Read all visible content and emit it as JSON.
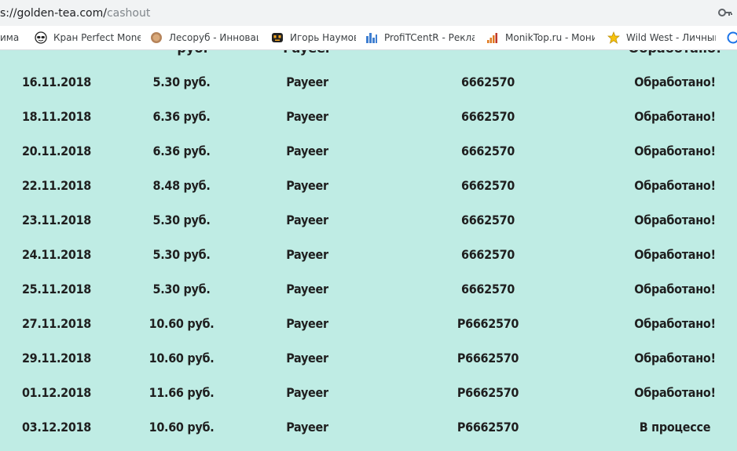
{
  "browser": {
    "url_host": "s://golden-tea.com/",
    "url_path": "cashout"
  },
  "bookmarks": [
    {
      "label": "има",
      "icon": "bookmark-icon"
    },
    {
      "label": "Кран Perfect Money",
      "icon": "mask-icon"
    },
    {
      "label": "Лесоруб - Инновац",
      "icon": "coin-icon"
    },
    {
      "label": "Игорь Наумов",
      "icon": "robot-icon"
    },
    {
      "label": "ProfiTCentR - Реклам",
      "icon": "bar-chart-icon"
    },
    {
      "label": "MonikTop.ru - Мони",
      "icon": "signal-icon"
    },
    {
      "label": "Wild West - Личный",
      "icon": "star-icon"
    },
    {
      "label": "",
      "icon": "globe-icon"
    }
  ],
  "table": {
    "columns": [
      "date",
      "amount",
      "system",
      "wallet",
      "status"
    ],
    "partial_row": [
      "руб.",
      "Payeer",
      "Обработано!"
    ],
    "rows": [
      [
        "16.11.2018",
        "5.30 руб.",
        "Payeer",
        "6662570",
        "Обработано!"
      ],
      [
        "18.11.2018",
        "6.36 руб.",
        "Payeer",
        "6662570",
        "Обработано!"
      ],
      [
        "20.11.2018",
        "6.36 руб.",
        "Payeer",
        "6662570",
        "Обработано!"
      ],
      [
        "22.11.2018",
        "8.48 руб.",
        "Payeer",
        "6662570",
        "Обработано!"
      ],
      [
        "23.11.2018",
        "5.30 руб.",
        "Payeer",
        "6662570",
        "Обработано!"
      ],
      [
        "24.11.2018",
        "5.30 руб.",
        "Payeer",
        "6662570",
        "Обработано!"
      ],
      [
        "25.11.2018",
        "5.30 руб.",
        "Payeer",
        "6662570",
        "Обработано!"
      ],
      [
        "27.11.2018",
        "10.60 руб.",
        "Payeer",
        "P6662570",
        "Обработано!"
      ],
      [
        "29.11.2018",
        "10.60 руб.",
        "Payeer",
        "P6662570",
        "Обработано!"
      ],
      [
        "01.12.2018",
        "11.66 руб.",
        "Payeer",
        "P6662570",
        "Обработано!"
      ],
      [
        "03.12.2018",
        "10.60 руб.",
        "Payeer",
        "P6662570",
        "В процессе"
      ]
    ]
  },
  "colors": {
    "page_background": "#bfece4",
    "text": "#1f1f1f"
  }
}
